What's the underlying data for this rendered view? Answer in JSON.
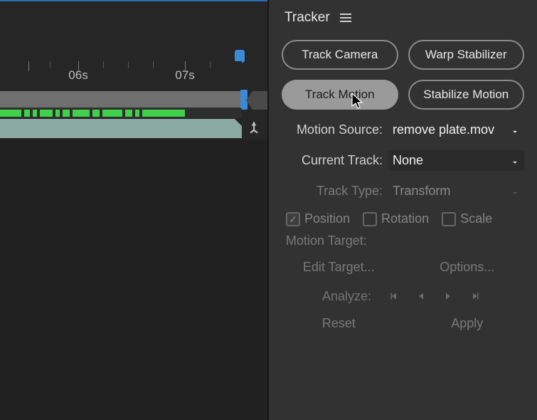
{
  "timeline": {
    "ticks": [
      "06s",
      "07s"
    ]
  },
  "panel": {
    "title": "Tracker",
    "buttons": {
      "track_camera": "Track Camera",
      "warp_stabilizer": "Warp Stabilizer",
      "track_motion": "Track Motion",
      "stabilize_motion": "Stabilize Motion"
    },
    "motion_source_label": "Motion Source:",
    "motion_source_value": "remove plate.mov",
    "current_track_label": "Current Track:",
    "current_track_value": "None",
    "track_type_label": "Track Type:",
    "track_type_value": "Transform",
    "checks": {
      "position": "Position",
      "rotation": "Rotation",
      "scale": "Scale"
    },
    "motion_target_label": "Motion Target:",
    "edit_target": "Edit Target...",
    "options": "Options...",
    "analyze_label": "Analyze:",
    "reset": "Reset",
    "apply": "Apply"
  }
}
